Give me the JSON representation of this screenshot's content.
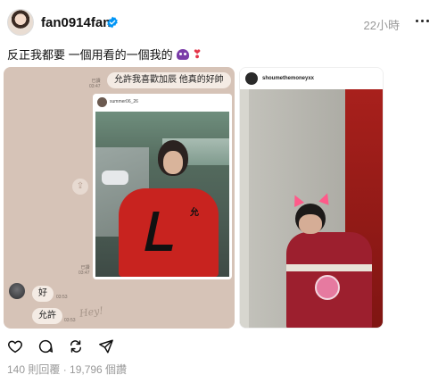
{
  "post": {
    "username": "fan0914fan",
    "time": "22小時",
    "caption": "反正我都要 一個用看的一個我的",
    "caption_emojis": [
      "ghost-emoji",
      "heart-emoji"
    ],
    "stats": "140 則回覆 · 19,796 個讚"
  },
  "image1": {
    "chat_time_top": "已讀\n03:47",
    "bubble_top": "允許我喜歡加辰 他真的好帥",
    "shared_post_username": "summer06_26",
    "chat_time_mid": "已讀\n03:47",
    "bubble_ok": "好",
    "time_ok": "03:53",
    "bubble_allow": "允許",
    "time_allow": "03:53",
    "scribble": "Hey!",
    "sweater_text": "允"
  },
  "image2": {
    "username": "shoumethemoneyxx"
  },
  "colors": {
    "verified": "#0095f6",
    "chat_bg": "#d6c3b7",
    "bubble": "#f4ebe4",
    "muted": "#999999"
  }
}
